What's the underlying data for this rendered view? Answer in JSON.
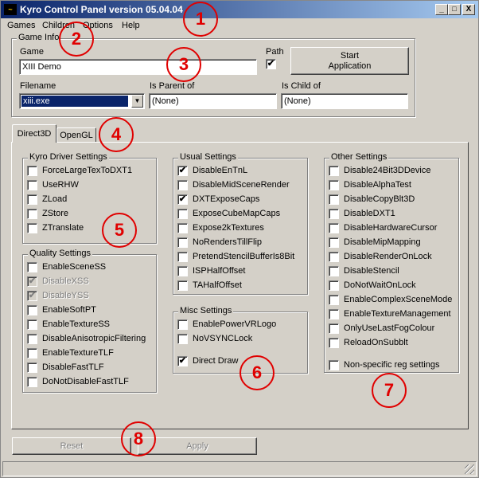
{
  "window": {
    "icon_text": "~",
    "title": "Kyro Control Panel version 05.04.04",
    "min_label": "_",
    "max_label": "□",
    "close_label": "X"
  },
  "menu": [
    {
      "label": "Games"
    },
    {
      "label": "Children"
    },
    {
      "label": "Options"
    },
    {
      "label": "Help"
    }
  ],
  "game_info": {
    "group_title": "Game Info",
    "game_label": "Game",
    "game_value": "XIII Demo",
    "path_label": "Path",
    "path_checked": "✔",
    "start_label_line1": "Start",
    "start_label_line2": "Application",
    "filename_label": "Filename",
    "filename_value": "xiii.exe",
    "is_parent_label": "Is Parent of",
    "is_parent_value": "(None)",
    "is_child_label": "Is Child of",
    "is_child_value": "(None)"
  },
  "tabs": [
    {
      "label": "Direct3D",
      "active": true
    },
    {
      "label": "OpenGL",
      "active": false
    }
  ],
  "kyro_driver": {
    "title": "Kyro Driver Settings",
    "items": [
      {
        "label": "ForceLargeTexToDXT1",
        "mark": ""
      },
      {
        "label": "UseRHW",
        "mark": ""
      },
      {
        "label": "ZLoad",
        "mark": ""
      },
      {
        "label": "ZStore",
        "mark": ""
      },
      {
        "label": "ZTranslate",
        "mark": ""
      }
    ]
  },
  "quality": {
    "title": "Quality Settings",
    "items": [
      {
        "label": "EnableSceneSS",
        "mark": ""
      },
      {
        "label": "DisableXSS",
        "mark": "✔",
        "disabled": true
      },
      {
        "label": "DisableYSS",
        "mark": "✔",
        "disabled": true
      },
      {
        "label": "EnableSoftPT",
        "mark": ""
      },
      {
        "label": "EnableTextureSS",
        "mark": ""
      },
      {
        "label": "DisableAnisotropicFiltering",
        "mark": ""
      },
      {
        "label": "EnableTextureTLF",
        "mark": ""
      },
      {
        "label": "DisableFastTLF",
        "mark": ""
      },
      {
        "label": "DoNotDisableFastTLF",
        "mark": ""
      }
    ]
  },
  "usual": {
    "title": "Usual Settings",
    "items": [
      {
        "label": "DisableEnTnL",
        "mark": "✔"
      },
      {
        "label": "DisableMidSceneRender",
        "mark": ""
      },
      {
        "label": "DXTExposeCaps",
        "mark": "✔"
      },
      {
        "label": "ExposeCubeMapCaps",
        "mark": ""
      },
      {
        "label": "Expose2kTextures",
        "mark": ""
      },
      {
        "label": "NoRendersTillFlip",
        "mark": ""
      },
      {
        "label": "PretendStencilBufferIs8Bit",
        "mark": ""
      },
      {
        "label": "ISPHalfOffset",
        "mark": ""
      },
      {
        "label": "TAHalfOffset",
        "mark": ""
      }
    ]
  },
  "misc": {
    "title": "Misc Settings",
    "items": [
      {
        "label": "EnablePowerVRLogo",
        "mark": ""
      },
      {
        "label": "NoVSYNCLock",
        "mark": ""
      },
      {
        "label": "Direct Draw",
        "mark": "✔"
      }
    ]
  },
  "other": {
    "title": "Other Settings",
    "items": [
      {
        "label": "Disable24Bit3DDevice",
        "mark": ""
      },
      {
        "label": "DisableAlphaTest",
        "mark": ""
      },
      {
        "label": "DisableCopyBlt3D",
        "mark": ""
      },
      {
        "label": "DisableDXT1",
        "mark": ""
      },
      {
        "label": "DisableHardwareCursor",
        "mark": ""
      },
      {
        "label": "DisableMipMapping",
        "mark": ""
      },
      {
        "label": "DisableRenderOnLock",
        "mark": ""
      },
      {
        "label": "DisableStencil",
        "mark": ""
      },
      {
        "label": "DoNotWaitOnLock",
        "mark": ""
      },
      {
        "label": "EnableComplexSceneMode",
        "mark": ""
      },
      {
        "label": "EnableTextureManagement",
        "mark": ""
      },
      {
        "label": "OnlyUseLastFogColour",
        "mark": ""
      },
      {
        "label": "ReloadOnSubblt",
        "mark": ""
      },
      {
        "label": "Non-specific reg settings",
        "mark": ""
      }
    ]
  },
  "actions": {
    "reset_label": "Reset",
    "apply_label": "Apply"
  },
  "markers": [
    "1",
    "2",
    "3",
    "4",
    "5",
    "6",
    "7",
    "8"
  ]
}
